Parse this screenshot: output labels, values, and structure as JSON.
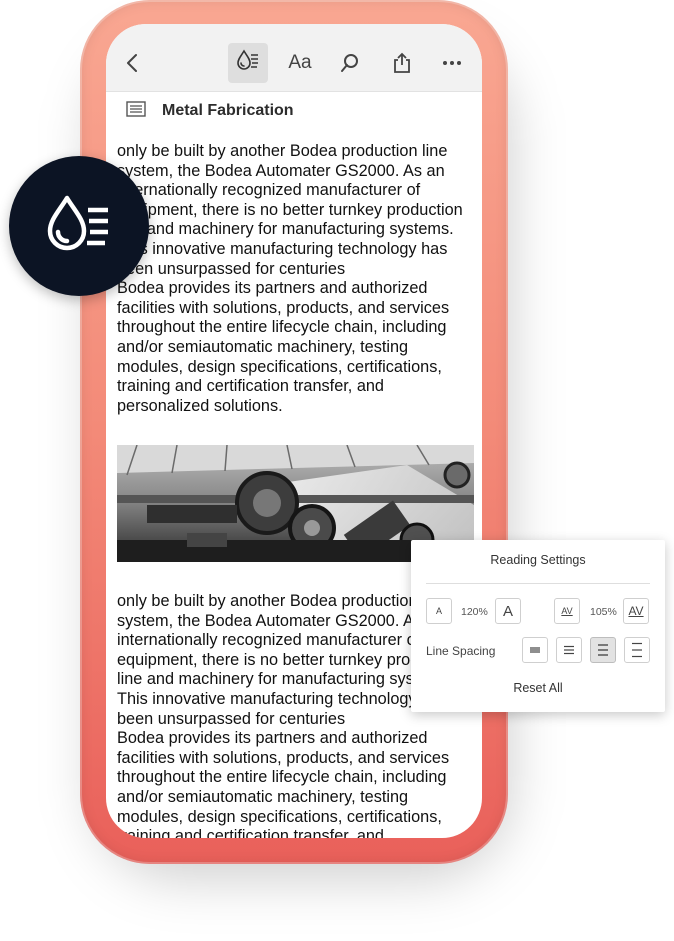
{
  "toolbar": {
    "back_icon": "chevron-left-icon",
    "liquid_mode_icon": "liquid-mode-icon",
    "text_size_label": "Aa",
    "search_icon": "search-icon",
    "share_icon": "share-icon",
    "more_icon": "more-icon"
  },
  "document": {
    "title": "Metal Fabrication",
    "paragraph1_lines": [
      "only be built by another Bodea production line",
      "system, the Bodea Automater GS2000. As an",
      "internationally recognized manufacturer of",
      "equipment, there is no better turnkey production",
      "line and machinery for manufacturing systems.",
      "This innovative manufacturing technology has",
      "been unsurpassed for centuries",
      "Bodea provides its partners and authorized",
      "facilities with solutions, products, and services",
      "throughout the entire lifecycle chain, including",
      "and/or semiautomatic machinery, testing",
      "modules, design specifications, certifications,",
      "training and certification transfer, and",
      "personalized solutions."
    ],
    "paragraph2_lines": [
      "only be built by another Bodea production line",
      "system, the Bodea Automater GS2000. As an",
      "internationally recognized manufacturer of",
      "equipment, there is no better turnkey production",
      "line and machinery for manufacturing systems.",
      "This innovative manufacturing technology has",
      "been unsurpassed for centuries",
      "Bodea provides its partners and authorized",
      "facilities with solutions, products, and services",
      "throughout the entire lifecycle chain, including",
      "and/or semiautomatic machinery, testing",
      "modules, design specifications, certifications,",
      "training and certification transfer, and"
    ]
  },
  "badge": {
    "icon": "liquid-mode-icon"
  },
  "reading_settings": {
    "title": "Reading Settings",
    "font_size_value": "120%",
    "char_spacing_value": "105%",
    "font_decrease_glyph": "A",
    "font_increase_glyph": "A",
    "spacing_glyph": "AV",
    "line_spacing_label": "Line Spacing",
    "line_spacing_selected_index": 2,
    "reset_label": "Reset All"
  },
  "colors": {
    "phone_top": "#f9a792",
    "phone_bottom": "#e9605a",
    "badge_bg": "#0c1424",
    "toolbar_bg": "#f2f2f2"
  }
}
